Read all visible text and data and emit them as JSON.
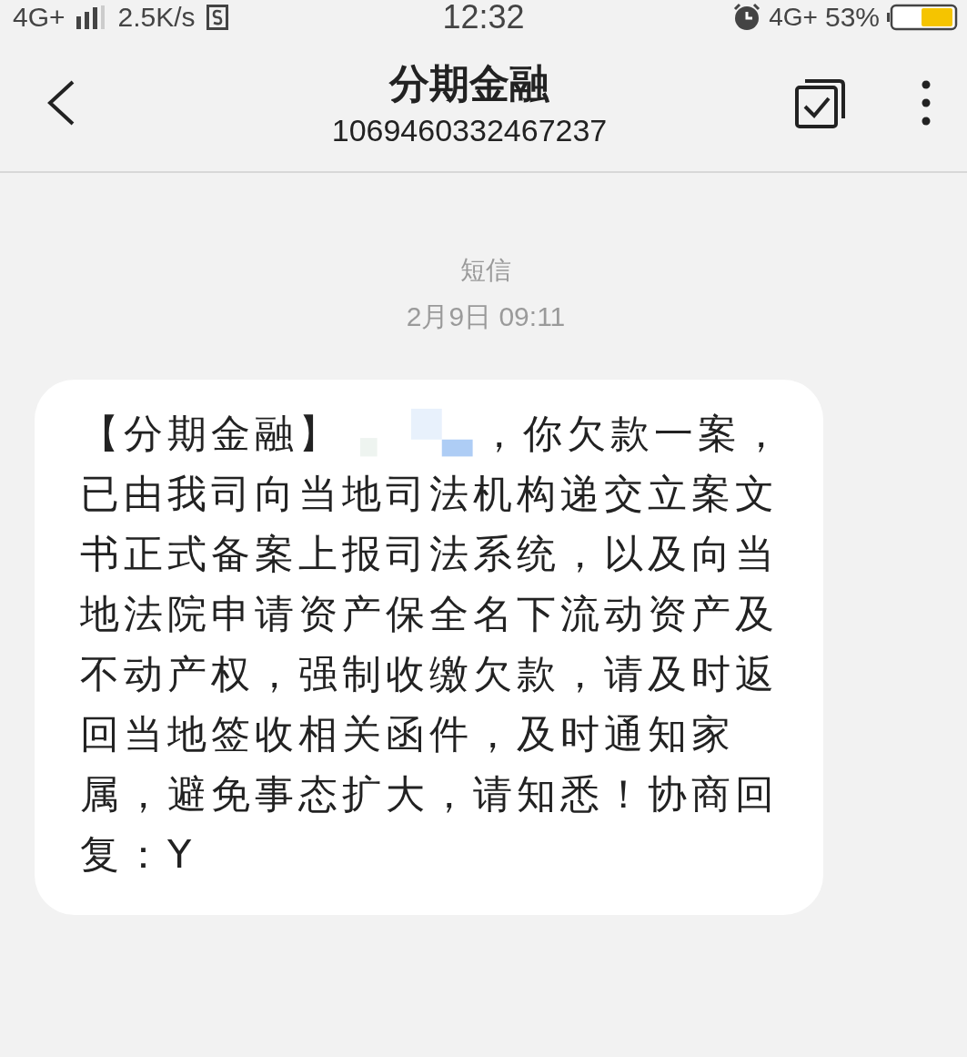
{
  "status_bar": {
    "network_left": "4G+",
    "speed": "2.5K/s",
    "time": "12:32",
    "network_right": "4G+",
    "battery": "53%"
  },
  "header": {
    "title": "分期金融",
    "number": "1069460332467237"
  },
  "conversation": {
    "channel": "短信",
    "timestamp": "2月9日 09:11",
    "message": {
      "before": "【分期金融】",
      "after": "，你欠款一案，",
      "rest": "已由我司向当地司法机构递交立案文书正式备案上报司法系统，以及向当地法院申请资产保全名下流动资产及不动产权，强制收缴欠款，请及时返回当地签收相关函件，及时通知家属，避免事态扩大，请知悉！协商回复：Y"
    }
  }
}
